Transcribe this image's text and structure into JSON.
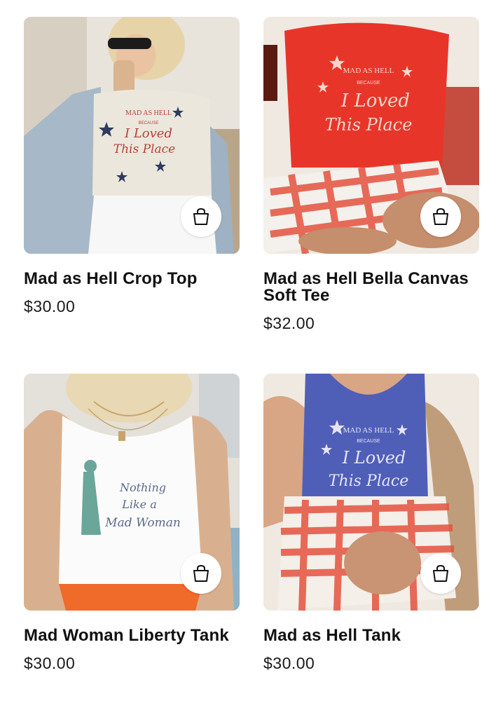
{
  "products": [
    {
      "name": "Mad as Hell Crop Top",
      "price": "$30.00",
      "shirt_print": [
        "MAD AS HELL",
        "BECAUSE",
        "I Loved",
        "This Place"
      ]
    },
    {
      "name": "Mad as Hell Bella Canvas Soft Tee",
      "price": "$32.00",
      "shirt_print": [
        "MAD AS HELL",
        "BECAUSE",
        "I Loved",
        "This Place"
      ]
    },
    {
      "name": "Mad Woman Liberty Tank",
      "price": "$30.00",
      "shirt_print": [
        "Nothing",
        "Like a",
        "Mad Woman"
      ]
    },
    {
      "name": "Mad as Hell Tank",
      "price": "$30.00",
      "shirt_print": [
        "MAD AS HELL",
        "BECAUSE",
        "I Loved",
        "This Place"
      ]
    }
  ],
  "icons": {
    "cart": "shopping-bag-icon"
  },
  "colors": {
    "text": "#111111",
    "red_tee": "#e8352a",
    "blue_tank": "#4f5fb8",
    "cream_top": "#ece7dc"
  }
}
